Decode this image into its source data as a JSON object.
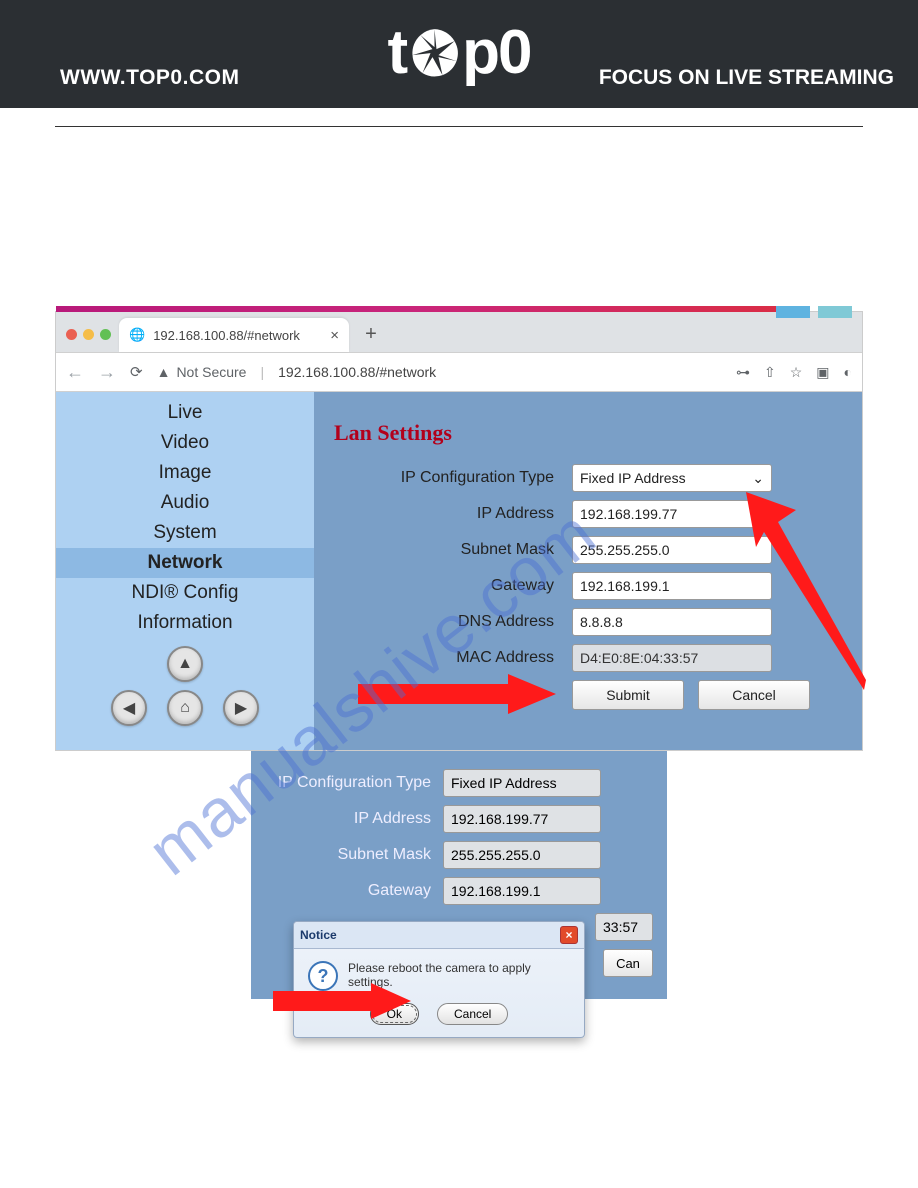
{
  "header": {
    "left": "WWW.TOP0.COM",
    "logo_pre": "t",
    "logo_post": "p0",
    "right": "FOCUS ON LIVE STREAMING"
  },
  "watermark": "manualshive.com",
  "browser": {
    "tab": {
      "title": "192.168.100.88/#network"
    },
    "security": "Not Secure",
    "address": "192.168.100.88/#network"
  },
  "sidebar": {
    "items": [
      {
        "label": "Live"
      },
      {
        "label": "Video"
      },
      {
        "label": "Image"
      },
      {
        "label": "Audio"
      },
      {
        "label": "System"
      },
      {
        "label": "Network"
      },
      {
        "label": "NDI® Config"
      },
      {
        "label": "Information"
      }
    ]
  },
  "lan": {
    "heading": "Lan Settings",
    "labels": {
      "ipconfig": "IP Configuration Type",
      "ip": "IP Address",
      "subnet": "Subnet Mask",
      "gateway": "Gateway",
      "dns": "DNS Address",
      "mac": "MAC Address"
    },
    "values": {
      "ipconfig": "Fixed IP Address",
      "ip": "192.168.199.77",
      "subnet": "255.255.255.0",
      "gateway": "192.168.199.1",
      "dns": "8.8.8.8",
      "mac": "D4:E0:8E:04:33:57"
    },
    "buttons": {
      "submit": "Submit",
      "cancel": "Cancel"
    }
  },
  "panel2": {
    "labels": {
      "ipconfig": "IP Configuration Type",
      "ip": "IP Address",
      "subnet": "Subnet Mask",
      "gateway": "Gateway"
    },
    "values": {
      "ipconfig": "Fixed IP Address",
      "ip": "192.168.199.77",
      "subnet": "255.255.255.0",
      "gateway": "192.168.199.1",
      "macpartial": "33:57"
    },
    "cancel_cut": "Can"
  },
  "dialog": {
    "title": "Notice",
    "message": "Please reboot the camera to apply settings.",
    "ok": "Ok",
    "cancel": "Cancel"
  }
}
